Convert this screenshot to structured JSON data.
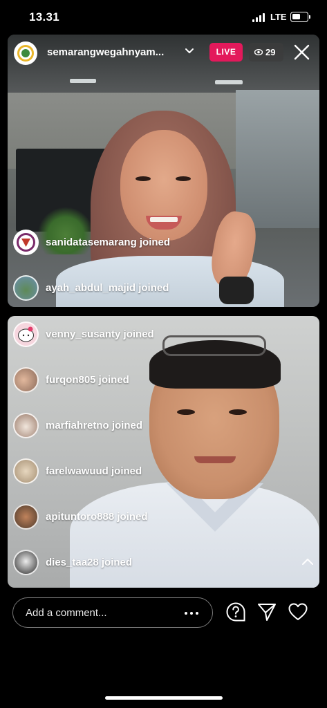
{
  "status_bar": {
    "time": "13.31",
    "network": "LTE"
  },
  "header": {
    "host_name": "semarangwegahnyam...",
    "live_label": "LIVE",
    "viewer_count": "29",
    "icons": {
      "viewers": "eye-icon",
      "close": "close-icon",
      "expand": "chevron-down-icon"
    }
  },
  "joins_top": [
    {
      "text": "sanidatasemarang joined",
      "avatar_color": "#ffffff"
    },
    {
      "text": "ayah_abdul_majid joined",
      "avatar_color": "#6b8fb0"
    }
  ],
  "joins_bottom": [
    {
      "text": "venny_susanty joined",
      "avatar_color": "#f6d6de"
    },
    {
      "text": "furqon805 joined",
      "avatar_color": "#caa693"
    },
    {
      "text": "marfiahretno joined",
      "avatar_color": "#d8c4b6"
    },
    {
      "text": "farelwawuud joined",
      "avatar_color": "#e0d2b8"
    },
    {
      "text": "apituntoro888 joined",
      "avatar_color": "#8a6a4f"
    },
    {
      "text": "dies_taa28 joined",
      "avatar_color": "#3c3c3c"
    }
  ],
  "comment": {
    "placeholder": "Add a comment..."
  },
  "actions": {
    "question": "question-icon",
    "share": "send-icon",
    "like": "heart-icon",
    "more": "more-dots-icon"
  },
  "colors": {
    "live": "#e3195b",
    "background": "#000000"
  }
}
